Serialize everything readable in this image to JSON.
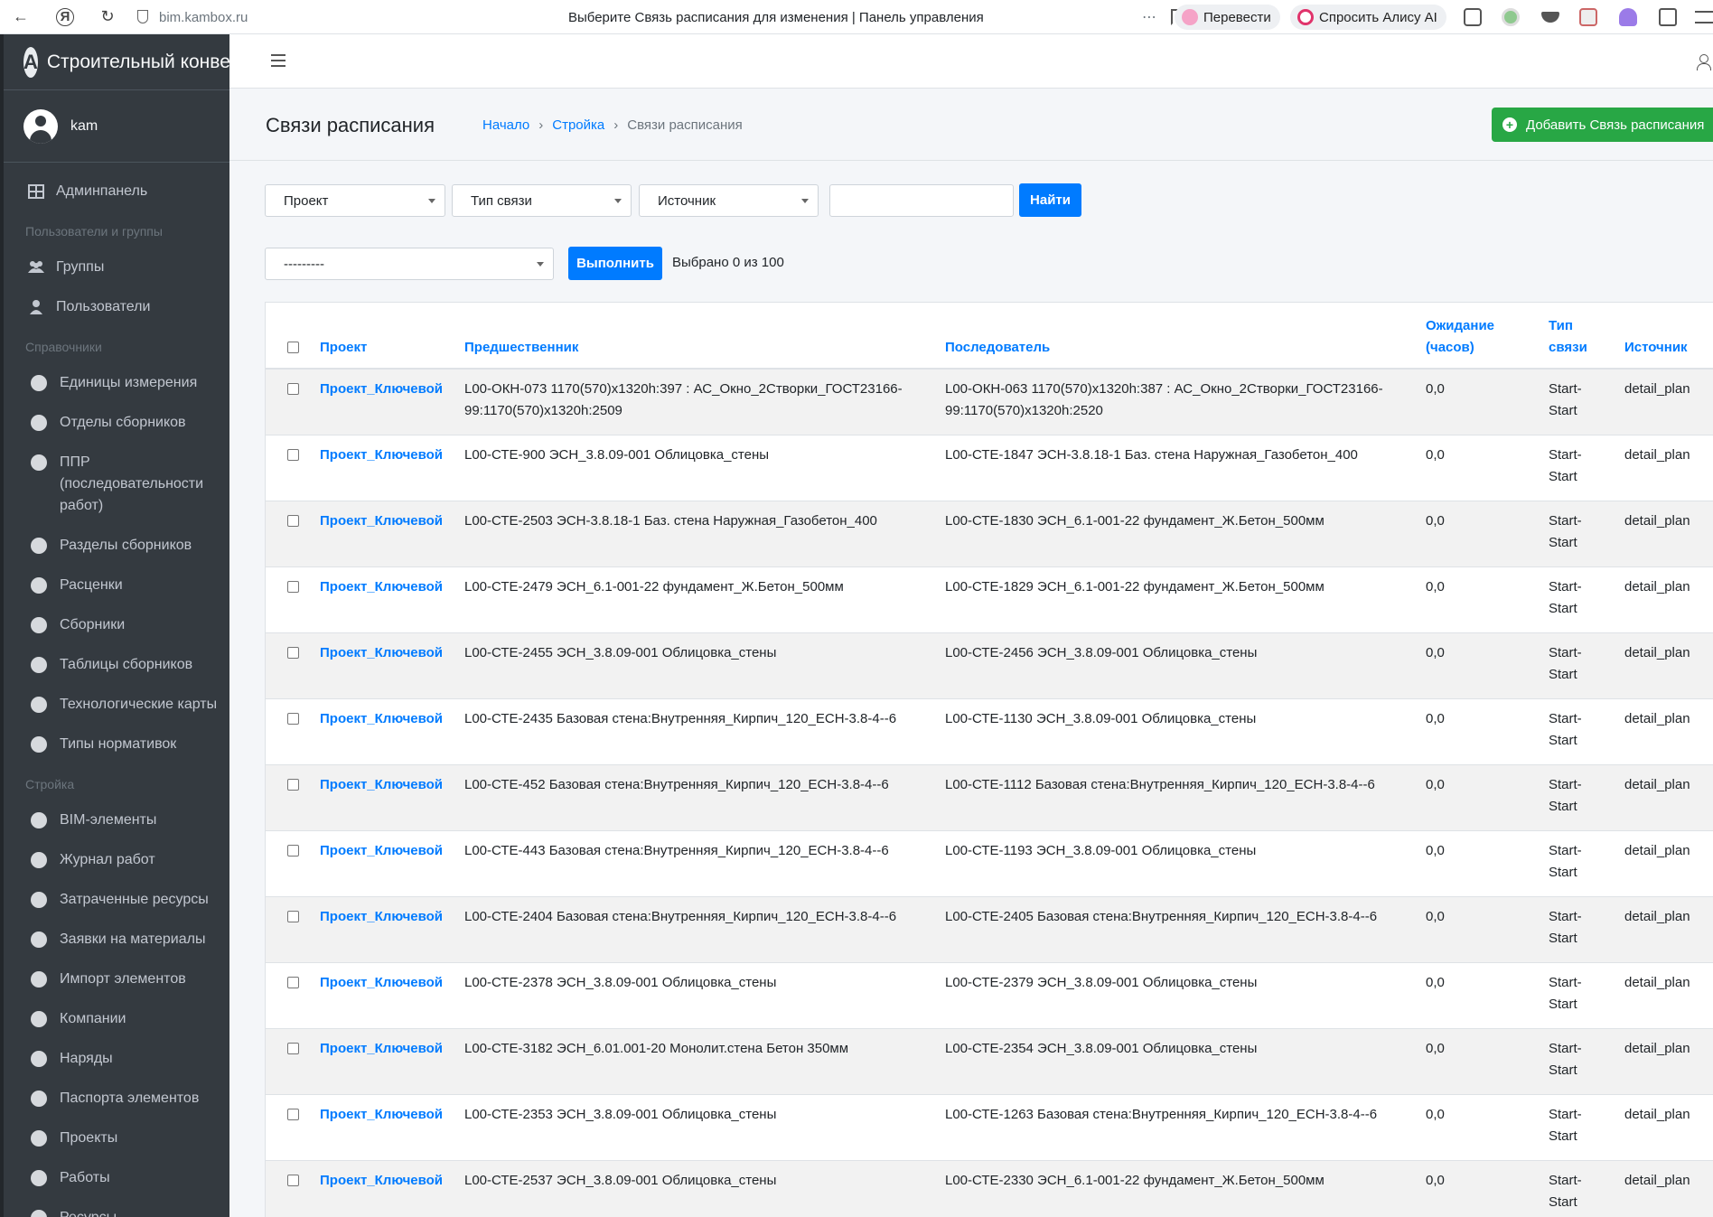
{
  "browser": {
    "url": "bim.kambox.ru",
    "tab_title": "Выберите Связь расписания для изменения | Панель управления",
    "translate_label": "Перевести",
    "alice_label": "Спросить Алису AI"
  },
  "sidebar": {
    "brand": "Строительный конвейер",
    "user": "kam",
    "admin_label": "Админпанель",
    "sections": [
      {
        "header": "Пользователи и группы",
        "items": [
          "Группы",
          "Пользователи"
        ]
      },
      {
        "header": "Справочники",
        "items": [
          "Единицы измерения",
          "Отделы сборников",
          "ППР (последовательности работ)",
          "Разделы сборников",
          "Расценки",
          "Сборники",
          "Таблицы сборников",
          "Технологические карты",
          "Типы нормативок"
        ]
      },
      {
        "header": "Стройка",
        "items": [
          "BIM-элементы",
          "Журнал работ",
          "Затраченные ресурсы",
          "Заявки на материалы",
          "Импорт элементов",
          "Компании",
          "Наряды",
          "Паспорта элементов",
          "Проекты",
          "Работы",
          "Ресурсы"
        ]
      }
    ]
  },
  "header": {
    "title": "Связи расписания",
    "breadcrumb": [
      "Начало",
      "Стройка",
      "Связи расписания"
    ],
    "add_button": "Добавить Связь расписания"
  },
  "filters": {
    "project": "Проект",
    "link_type": "Тип связи",
    "source": "Источник",
    "search_value": "",
    "search_button": "Найти"
  },
  "actions": {
    "select_value": "---------",
    "run_button": "Выполнить",
    "counter": "Выбрано 0 из 100"
  },
  "table": {
    "columns": [
      "Проект",
      "Предшественник",
      "Последователь",
      "Ожидание (часов)",
      "Тип связи",
      "Источник"
    ],
    "rows": [
      {
        "project": "Проект_Ключевой",
        "predecessor": "L00-ОКН-073 1170(570)x1320h:397 : АС_Окно_2Створки_ГОСТ23166-99:1170(570)x1320h:2509",
        "successor": "L00-ОКН-063 1170(570)x1320h:387 : АС_Окно_2Створки_ГОСТ23166-99:1170(570)x1320h:2520",
        "wait": "0,0",
        "type": "Start-Start",
        "source": "detail_plan"
      },
      {
        "project": "Проект_Ключевой",
        "predecessor": "L00-СТЕ-900 ЭСН_3.8.09-001 Облицовка_стены",
        "successor": "L00-СТЕ-1847 ЭСН-3.8.18-1 Баз. стена Наружная_Газобетон_400",
        "wait": "0,0",
        "type": "Start-Start",
        "source": "detail_plan"
      },
      {
        "project": "Проект_Ключевой",
        "predecessor": "L00-СТЕ-2503 ЭСН-3.8.18-1 Баз. стена Наружная_Газобетон_400",
        "successor": "L00-СТЕ-1830 ЭСН_6.1-001-22 фундамент_Ж.Бетон_500мм",
        "wait": "0,0",
        "type": "Start-Start",
        "source": "detail_plan"
      },
      {
        "project": "Проект_Ключевой",
        "predecessor": "L00-СТЕ-2479 ЭСН_6.1-001-22 фундамент_Ж.Бетон_500мм",
        "successor": "L00-СТЕ-1829 ЭСН_6.1-001-22 фундамент_Ж.Бетон_500мм",
        "wait": "0,0",
        "type": "Start-Start",
        "source": "detail_plan"
      },
      {
        "project": "Проект_Ключевой",
        "predecessor": "L00-СТЕ-2455 ЭСН_3.8.09-001 Облицовка_стены",
        "successor": "L00-СТЕ-2456 ЭСН_3.8.09-001 Облицовка_стены",
        "wait": "0,0",
        "type": "Start-Start",
        "source": "detail_plan"
      },
      {
        "project": "Проект_Ключевой",
        "predecessor": "L00-СТЕ-2435 Базовая стена:Внутренняя_Кирпич_120_ЕСН-3.8-4--6",
        "successor": "L00-СТЕ-1130 ЭСН_3.8.09-001 Облицовка_стены",
        "wait": "0,0",
        "type": "Start-Start",
        "source": "detail_plan"
      },
      {
        "project": "Проект_Ключевой",
        "predecessor": "L00-СТЕ-452 Базовая стена:Внутренняя_Кирпич_120_ЕСН-3.8-4--6",
        "successor": "L00-СТЕ-1112 Базовая стена:Внутренняя_Кирпич_120_ЕСН-3.8-4--6",
        "wait": "0,0",
        "type": "Start-Start",
        "source": "detail_plan"
      },
      {
        "project": "Проект_Ключевой",
        "predecessor": "L00-СТЕ-443 Базовая стена:Внутренняя_Кирпич_120_ЕСН-3.8-4--6",
        "successor": "L00-СТЕ-1193 ЭСН_3.8.09-001 Облицовка_стены",
        "wait": "0,0",
        "type": "Start-Start",
        "source": "detail_plan"
      },
      {
        "project": "Проект_Ключевой",
        "predecessor": "L00-СТЕ-2404 Базовая стена:Внутренняя_Кирпич_120_ЕСН-3.8-4--6",
        "successor": "L00-СТЕ-2405 Базовая стена:Внутренняя_Кирпич_120_ЕСН-3.8-4--6",
        "wait": "0,0",
        "type": "Start-Start",
        "source": "detail_plan"
      },
      {
        "project": "Проект_Ключевой",
        "predecessor": "L00-СТЕ-2378 ЭСН_3.8.09-001 Облицовка_стены",
        "successor": "L00-СТЕ-2379 ЭСН_3.8.09-001 Облицовка_стены",
        "wait": "0,0",
        "type": "Start-Start",
        "source": "detail_plan"
      },
      {
        "project": "Проект_Ключевой",
        "predecessor": "L00-СТЕ-3182 ЭСН_6.01.001-20 Монолит.стена Бетон 350мм",
        "successor": "L00-СТЕ-2354 ЭСН_3.8.09-001 Облицовка_стены",
        "wait": "0,0",
        "type": "Start-Start",
        "source": "detail_plan"
      },
      {
        "project": "Проект_Ключевой",
        "predecessor": "L00-СТЕ-2353 ЭСН_3.8.09-001 Облицовка_стены",
        "successor": "L00-СТЕ-1263 Базовая стена:Внутренняя_Кирпич_120_ЕСН-3.8-4--6",
        "wait": "0,0",
        "type": "Start-Start",
        "source": "detail_plan"
      },
      {
        "project": "Проект_Ключевой",
        "predecessor": "L00-СТЕ-2537 ЭСН_3.8.09-001 Облицовка_стены",
        "successor": "L00-СТЕ-2330 ЭСН_6.1-001-22 фундамент_Ж.Бетон_500мм",
        "wait": "0,0",
        "type": "Start-Start",
        "source": "detail_plan"
      }
    ]
  }
}
